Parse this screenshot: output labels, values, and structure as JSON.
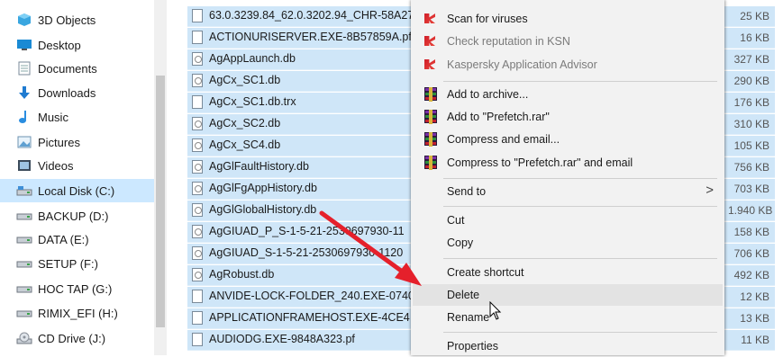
{
  "nav": {
    "items": [
      {
        "label": "3D Objects",
        "icon": "3d-objects-icon",
        "selected": false
      },
      {
        "label": "Desktop",
        "icon": "desktop-icon",
        "selected": false
      },
      {
        "label": "Documents",
        "icon": "documents-icon",
        "selected": false
      },
      {
        "label": "Downloads",
        "icon": "downloads-icon",
        "selected": false
      },
      {
        "label": "Music",
        "icon": "music-icon",
        "selected": false
      },
      {
        "label": "Pictures",
        "icon": "pictures-icon",
        "selected": false
      },
      {
        "label": "Videos",
        "icon": "videos-icon",
        "selected": false
      },
      {
        "label": "Local Disk (C:)",
        "icon": "local-disk-icon",
        "selected": true
      },
      {
        "label": "BACKUP (D:)",
        "icon": "drive-icon",
        "selected": false
      },
      {
        "label": "DATA (E:)",
        "icon": "drive-icon",
        "selected": false
      },
      {
        "label": "SETUP (F:)",
        "icon": "drive-icon",
        "selected": false
      },
      {
        "label": "HOC TAP (G:)",
        "icon": "drive-icon",
        "selected": false
      },
      {
        "label": "RIMIX_EFI (H:)",
        "icon": "drive-icon",
        "selected": false
      },
      {
        "label": "CD Drive (J:)",
        "icon": "cd-drive-icon",
        "selected": false
      }
    ]
  },
  "files": [
    {
      "name": "63.0.3239.84_62.0.3202.94_CHR-58A27",
      "size": "25 KB",
      "type": "file"
    },
    {
      "name": "ACTIONURISERVER.EXE-8B57859A.pf",
      "size": "16 KB",
      "type": "file"
    },
    {
      "name": "AgAppLaunch.db",
      "size": "327 KB",
      "type": "db"
    },
    {
      "name": "AgCx_SC1.db",
      "size": "290 KB",
      "type": "db"
    },
    {
      "name": "AgCx_SC1.db.trx",
      "size": "176 KB",
      "type": "file"
    },
    {
      "name": "AgCx_SC2.db",
      "size": "310 KB",
      "type": "db"
    },
    {
      "name": "AgCx_SC4.db",
      "size": "105 KB",
      "type": "db"
    },
    {
      "name": "AgGlFaultHistory.db",
      "size": "756 KB",
      "type": "db"
    },
    {
      "name": "AgGlFgAppHistory.db",
      "size": "703 KB",
      "type": "db"
    },
    {
      "name": "AgGlGlobalHistory.db",
      "size": "1.940 KB",
      "type": "db"
    },
    {
      "name": "AgGIUAD_P_S-1-5-21-2530697930-11",
      "size": "158 KB",
      "type": "db"
    },
    {
      "name": "AgGIUAD_S-1-5-21-2530697930-1120",
      "size": "706 KB",
      "type": "db"
    },
    {
      "name": "AgRobust.db",
      "size": "492 KB",
      "type": "db"
    },
    {
      "name": "ANVIDE-LOCK-FOLDER_240.EXE-0740",
      "size": "12 KB",
      "type": "file"
    },
    {
      "name": "APPLICATIONFRAMEHOST.EXE-4CE4",
      "size": "13 KB",
      "type": "file"
    },
    {
      "name": "AUDIODG.EXE-9848A323.pf",
      "size": "11 KB",
      "type": "file"
    }
  ],
  "menu": {
    "scan": "Scan for viruses",
    "reputation": "Check reputation in KSN",
    "advisor": "Kaspersky Application Advisor",
    "add_archive": "Add to archive...",
    "add_rar": "Add to \"Prefetch.rar\"",
    "compress_email": "Compress and email...",
    "compress_rar_email": "Compress to \"Prefetch.rar\" and email",
    "send_to": "Send to",
    "send_to_arrow": ">",
    "cut": "Cut",
    "copy": "Copy",
    "create_shortcut": "Create shortcut",
    "delete": "Delete",
    "rename": "Rename",
    "properties": "Properties"
  },
  "colors": {
    "selection": "#cfe6f8",
    "menu_bg": "#f2f2f2",
    "menu_hover": "#e3e3e3",
    "arrow": "#e5202b"
  }
}
